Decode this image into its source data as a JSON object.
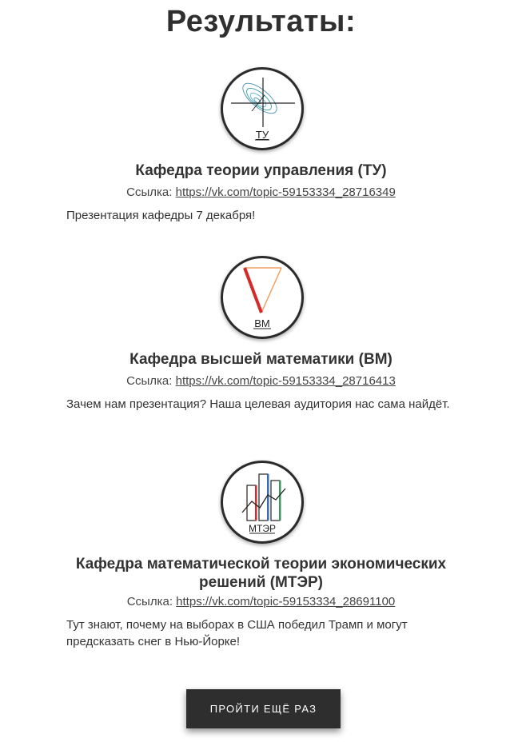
{
  "header": {
    "title": "Результаты:"
  },
  "link_label": "Ссылка:",
  "departments": [
    {
      "logo_text": "ТУ",
      "name": "Кафедра теории управления (ТУ)",
      "url": "https://vk.com/topic-59153334_28716349",
      "description": "Презентация кафедры 7 декабря!"
    },
    {
      "logo_text": "ВМ",
      "name": "Кафедра высшей математики (ВМ)",
      "url": "https://vk.com/topic-59153334_28716413",
      "description": "Зачем нам презентация? Наша целевая аудитория нас сама найдёт."
    },
    {
      "logo_text": "МТЭР",
      "name": "Кафедра математической теории экономических решений (МТЭР)",
      "url": "https://vk.com/topic-59153334_28691100",
      "description": "Тут знают, почему на выборах в США победил Трамп и могут предсказать снег в Нью-Йорке!"
    }
  ],
  "footer": {
    "retry_button": "ПРОЙТИ ЕЩЁ РАЗ"
  },
  "colors": {
    "button_bg": "#2e2e2e",
    "logo_red": "#d42a2a",
    "logo_orange": "#f0a060",
    "logo_teal": "#3a9a9a"
  }
}
